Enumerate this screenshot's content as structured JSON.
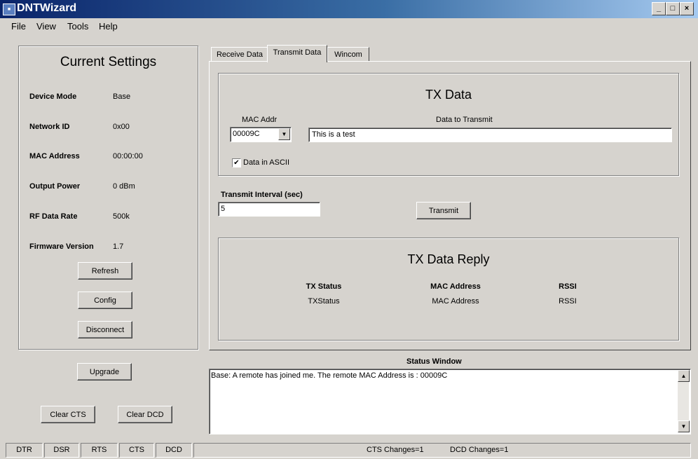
{
  "window": {
    "title": "DNTWizard",
    "icon": "app-icon"
  },
  "menu": {
    "items": [
      "File",
      "View",
      "Tools",
      "Help"
    ]
  },
  "current_settings": {
    "title": "Current Settings",
    "rows": [
      {
        "label": "Device Mode",
        "value": "Base"
      },
      {
        "label": "Network ID",
        "value": "0x00"
      },
      {
        "label": "MAC Address",
        "value": "00:00:00"
      },
      {
        "label": "Output Power",
        "value": "0 dBm"
      },
      {
        "label": "RF Data Rate",
        "value": "500k"
      },
      {
        "label": "Firmware Version",
        "value": "1.7"
      }
    ],
    "refresh_label": "Refresh",
    "config_label": "Config",
    "disconnect_label": "Disconnect"
  },
  "left_buttons": {
    "upgrade_label": "Upgrade",
    "clear_cts_label": "Clear CTS",
    "clear_dcd_label": "Clear DCD"
  },
  "tabs": [
    "Receive Data",
    "Transmit Data",
    "Wincom"
  ],
  "tx_data": {
    "title": "TX Data",
    "mac_addr_label": "MAC Addr",
    "mac_addr_value": "00009C",
    "data_to_transmit_label": "Data to Transmit",
    "data_value": "This is a test",
    "ascii_label": "Data in ASCII",
    "ascii_checked": true
  },
  "transmit_interval": {
    "label": "Transmit Interval (sec)",
    "value": "5"
  },
  "transmit_label": "Transmit",
  "tx_reply": {
    "title": "TX Data Reply",
    "headers": [
      "TX Status",
      "MAC Address",
      "RSSI"
    ],
    "values": [
      "TXStatus",
      "MAC Address",
      "RSSI"
    ]
  },
  "status_window": {
    "title": "Status Window",
    "text": "Base: A remote has joined me. The remote MAC Address is : 00009C"
  },
  "status_bar": {
    "indicators": [
      "DTR",
      "DSR",
      "RTS",
      "CTS",
      "DCD"
    ],
    "cts_changes": "CTS Changes=1",
    "dcd_changes": "DCD Changes=1"
  }
}
